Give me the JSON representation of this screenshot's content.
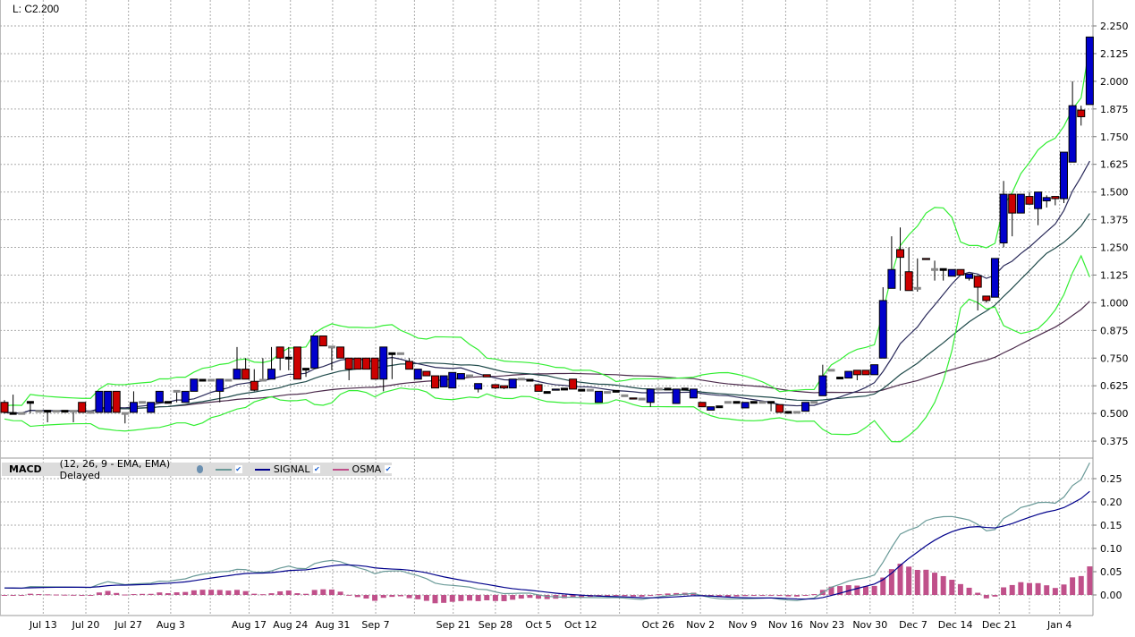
{
  "header": {
    "last_label": "L: C2.200"
  },
  "legend": {
    "name": "MACD",
    "params": "(12, 26, 9 - EMA, EMA) Delayed",
    "signal": "SIGNAL",
    "osma": "OSMA",
    "macd_color": "#6a9a98",
    "signal_color": "#00008b",
    "osma_color": "#c0508a",
    "check": "✔"
  },
  "colors": {
    "up": "#0000cc",
    "down": "#cc0000",
    "band": "#33ee33",
    "ma_fast": "#2a2a5a",
    "ma_mid": "#1f4a4a",
    "ma_slow": "#4b2a4b"
  },
  "chart_data": [
    {
      "type": "candlestick",
      "title": "Price",
      "ylim": [
        0.3,
        2.3
      ],
      "yticks": [
        "2.250",
        "2.125",
        "2.000",
        "1.875",
        "1.750",
        "1.625",
        "1.500",
        "1.375",
        "1.250",
        "1.125",
        "1.000",
        "0.875",
        "0.750",
        "0.625",
        "0.500",
        "0.375"
      ],
      "x_labels": [
        {
          "i": 4.5,
          "t": "Jul 13"
        },
        {
          "i": 9.45,
          "t": "Jul 20"
        },
        {
          "i": 14.4,
          "t": "Jul 27"
        },
        {
          "i": 19.3,
          "t": "Aug 3"
        },
        {
          "i": 28.4,
          "t": "Aug 17"
        },
        {
          "i": 33.2,
          "t": "Aug 24"
        },
        {
          "i": 38.1,
          "t": "Aug 31"
        },
        {
          "i": 43.1,
          "t": "Sep 7"
        },
        {
          "i": 52.1,
          "t": "Sep 21"
        },
        {
          "i": 57,
          "t": "Sep 28"
        },
        {
          "i": 62,
          "t": "Oct 5"
        },
        {
          "i": 66.9,
          "t": "Oct 12"
        },
        {
          "i": 75.9,
          "t": "Oct 26"
        },
        {
          "i": 80.8,
          "t": "Nov 2"
        },
        {
          "i": 85.7,
          "t": "Nov 9"
        },
        {
          "i": 90.7,
          "t": "Nov 16"
        },
        {
          "i": 95.5,
          "t": "Nov 23"
        },
        {
          "i": 100.5,
          "t": "Nov 30"
        },
        {
          "i": 105.5,
          "t": "Dec 7"
        },
        {
          "i": 110.4,
          "t": "Dec 14"
        },
        {
          "i": 115.5,
          "t": "Dec 21"
        },
        {
          "i": 122.5,
          "t": "Jan 4"
        }
      ],
      "ohlc": [
        [
          0.55,
          0.56,
          0.5,
          0.505
        ],
        [
          0.5,
          0.585,
          0.5,
          0.5
        ],
        [
          0.5,
          0.5,
          0.5,
          0.5
        ],
        [
          0.55,
          0.55,
          0.5,
          0.55
        ],
        [
          0.51,
          0.51,
          0.51,
          0.51
        ],
        [
          0.51,
          0.51,
          0.46,
          0.51
        ],
        [
          0.51,
          0.51,
          0.51,
          0.51
        ],
        [
          0.51,
          0.51,
          0.51,
          0.51
        ],
        [
          0.51,
          0.51,
          0.46,
          0.51
        ],
        [
          0.55,
          0.55,
          0.505,
          0.505
        ],
        [
          0.505,
          0.505,
          0.505,
          0.505
        ],
        [
          0.505,
          0.6,
          0.505,
          0.6
        ],
        [
          0.505,
          0.6,
          0.505,
          0.6
        ],
        [
          0.6,
          0.6,
          0.505,
          0.505
        ],
        [
          0.5,
          0.5,
          0.455,
          0.5
        ],
        [
          0.505,
          0.6,
          0.505,
          0.55
        ],
        [
          0.55,
          0.55,
          0.55,
          0.55
        ],
        [
          0.505,
          0.55,
          0.505,
          0.55
        ],
        [
          0.55,
          0.6,
          0.55,
          0.6
        ],
        [
          0.55,
          0.55,
          0.55,
          0.55
        ],
        [
          0.6,
          0.6,
          0.55,
          0.6
        ],
        [
          0.55,
          0.6,
          0.55,
          0.6
        ],
        [
          0.6,
          0.655,
          0.6,
          0.655
        ],
        [
          0.65,
          0.65,
          0.65,
          0.65
        ],
        [
          0.65,
          0.65,
          0.65,
          0.65
        ],
        [
          0.6,
          0.655,
          0.55,
          0.655
        ],
        [
          0.65,
          0.65,
          0.65,
          0.65
        ],
        [
          0.655,
          0.8,
          0.655,
          0.7
        ],
        [
          0.7,
          0.75,
          0.655,
          0.655
        ],
        [
          0.645,
          0.7,
          0.6,
          0.605
        ],
        [
          0.65,
          0.75,
          0.65,
          0.65
        ],
        [
          0.655,
          0.8,
          0.655,
          0.7
        ],
        [
          0.8,
          0.8,
          0.695,
          0.75
        ],
        [
          0.75,
          0.8,
          0.695,
          0.75
        ],
        [
          0.8,
          0.8,
          0.655,
          0.655
        ],
        [
          0.7,
          0.7,
          0.665,
          0.7
        ],
        [
          0.705,
          0.85,
          0.705,
          0.85
        ],
        [
          0.85,
          0.85,
          0.805,
          0.805
        ],
        [
          0.8,
          0.8,
          0.695,
          0.8
        ],
        [
          0.8,
          0.8,
          0.75,
          0.75
        ],
        [
          0.75,
          0.75,
          0.65,
          0.7
        ],
        [
          0.75,
          0.75,
          0.7,
          0.7
        ],
        [
          0.75,
          0.75,
          0.7,
          0.7
        ],
        [
          0.75,
          0.75,
          0.655,
          0.655
        ],
        [
          0.655,
          0.8,
          0.6,
          0.8
        ],
        [
          0.77,
          0.77,
          0.655,
          0.77
        ],
        [
          0.77,
          0.77,
          0.77,
          0.77
        ],
        [
          0.735,
          0.75,
          0.7,
          0.7
        ],
        [
          0.655,
          0.7,
          0.655,
          0.7
        ],
        [
          0.69,
          0.69,
          0.67,
          0.67
        ],
        [
          0.67,
          0.67,
          0.615,
          0.615
        ],
        [
          0.62,
          0.67,
          0.62,
          0.67
        ],
        [
          0.615,
          0.685,
          0.615,
          0.685
        ],
        [
          0.655,
          0.68,
          0.655,
          0.68
        ],
        [
          0.67,
          0.67,
          0.67,
          0.67
        ],
        [
          0.61,
          0.635,
          0.595,
          0.635
        ],
        [
          0.675,
          0.675,
          0.665,
          0.665
        ],
        [
          0.63,
          0.63,
          0.61,
          0.615
        ],
        [
          0.625,
          0.625,
          0.61,
          0.615
        ],
        [
          0.615,
          0.655,
          0.615,
          0.655
        ],
        [
          0.655,
          0.655,
          0.655,
          0.655
        ],
        [
          0.65,
          0.65,
          0.65,
          0.65
        ],
        [
          0.63,
          0.63,
          0.6,
          0.6
        ],
        [
          0.595,
          0.595,
          0.595,
          0.595
        ],
        [
          0.605,
          0.61,
          0.605,
          0.61
        ],
        [
          0.61,
          0.61,
          0.61,
          0.61
        ],
        [
          0.655,
          0.655,
          0.61,
          0.61
        ],
        [
          0.605,
          0.605,
          0.605,
          0.605
        ],
        [
          0.605,
          0.605,
          0.605,
          0.605
        ],
        [
          0.55,
          0.6,
          0.55,
          0.6
        ],
        [
          0.595,
          0.595,
          0.595,
          0.595
        ],
        [
          0.6,
          0.6,
          0.6,
          0.6
        ],
        [
          0.58,
          0.58,
          0.58,
          0.58
        ],
        [
          0.57,
          0.57,
          0.565,
          0.565
        ],
        [
          0.565,
          0.565,
          0.565,
          0.565
        ],
        [
          0.55,
          0.61,
          0.53,
          0.61
        ],
        [
          0.61,
          0.61,
          0.61,
          0.61
        ],
        [
          0.61,
          0.61,
          0.61,
          0.61
        ],
        [
          0.545,
          0.61,
          0.545,
          0.61
        ],
        [
          0.61,
          0.61,
          0.61,
          0.61
        ],
        [
          0.57,
          0.61,
          0.57,
          0.61
        ],
        [
          0.55,
          0.55,
          0.53,
          0.53
        ],
        [
          0.515,
          0.53,
          0.515,
          0.53
        ],
        [
          0.53,
          0.53,
          0.53,
          0.53
        ],
        [
          0.55,
          0.55,
          0.55,
          0.55
        ],
        [
          0.55,
          0.55,
          0.55,
          0.55
        ],
        [
          0.525,
          0.55,
          0.525,
          0.55
        ],
        [
          0.55,
          0.55,
          0.55,
          0.55
        ],
        [
          0.55,
          0.55,
          0.55,
          0.55
        ],
        [
          0.55,
          0.55,
          0.51,
          0.55
        ],
        [
          0.54,
          0.54,
          0.505,
          0.505
        ],
        [
          0.505,
          0.505,
          0.505,
          0.505
        ],
        [
          0.505,
          0.505,
          0.505,
          0.505
        ],
        [
          0.51,
          0.55,
          0.51,
          0.55
        ],
        [
          0.55,
          0.55,
          0.55,
          0.55
        ],
        [
          0.58,
          0.72,
          0.58,
          0.67
        ],
        [
          0.695,
          0.695,
          0.695,
          0.695
        ],
        [
          0.66,
          0.66,
          0.66,
          0.66
        ],
        [
          0.66,
          0.69,
          0.66,
          0.69
        ],
        [
          0.695,
          0.695,
          0.65,
          0.675
        ],
        [
          0.695,
          0.695,
          0.675,
          0.675
        ],
        [
          0.675,
          0.72,
          0.675,
          0.72
        ],
        [
          0.75,
          1.07,
          0.75,
          1.01
        ],
        [
          1.065,
          1.3,
          1.065,
          1.15
        ],
        [
          1.24,
          1.34,
          1.055,
          1.205
        ],
        [
          1.14,
          1.25,
          1.055,
          1.055
        ],
        [
          1.065,
          1.2,
          1.05,
          1.065
        ],
        [
          1.2,
          1.2,
          1.195,
          1.195
        ],
        [
          1.15,
          1.19,
          1.1,
          1.15
        ],
        [
          1.15,
          1.15,
          1.1,
          1.15
        ],
        [
          1.12,
          1.15,
          1.12,
          1.15
        ],
        [
          1.15,
          1.15,
          1.125,
          1.125
        ],
        [
          1.11,
          1.13,
          1.1,
          1.13
        ],
        [
          1.12,
          1.12,
          0.965,
          1.07
        ],
        [
          1.03,
          1.03,
          1.0,
          1.01
        ],
        [
          1.025,
          1.2,
          1.025,
          1.2
        ],
        [
          1.27,
          1.55,
          1.25,
          1.49
        ],
        [
          1.49,
          1.49,
          1.3,
          1.405
        ],
        [
          1.405,
          1.49,
          1.405,
          1.49
        ],
        [
          1.48,
          1.5,
          1.445,
          1.445
        ],
        [
          1.425,
          1.5,
          1.35,
          1.5
        ],
        [
          1.46,
          1.485,
          1.43,
          1.475
        ],
        [
          1.48,
          1.48,
          1.44,
          1.47
        ],
        [
          1.47,
          1.68,
          1.45,
          1.68
        ],
        [
          1.635,
          2.0,
          1.635,
          1.89
        ],
        [
          1.87,
          1.89,
          1.8,
          1.84
        ],
        [
          1.895,
          2.2,
          1.895,
          2.2
        ]
      ]
    },
    {
      "type": "line+bar",
      "title": "MACD (12, 26, 9 - EMA, EMA)",
      "ylim": [
        -0.045,
        0.28
      ],
      "yticks": [
        "0.25",
        "0.20",
        "0.15",
        "0.10",
        "0.05",
        "0.00"
      ],
      "series": [
        "MACD",
        "SIGNAL",
        "OSMA"
      ]
    }
  ]
}
